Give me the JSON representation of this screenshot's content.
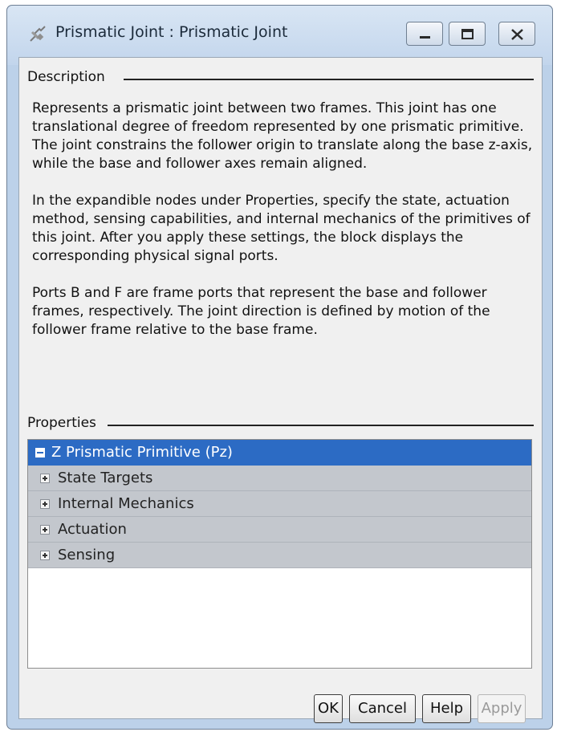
{
  "window": {
    "title": "Prismatic Joint : Prismatic  Joint"
  },
  "description": {
    "heading": "Description",
    "paragraphs": [
      "Represents a prismatic joint between two frames. This joint has one translational degree of freedom represented by one prismatic primitive. The joint constrains the follower origin to translate along the base z-axis, while the base and follower axes remain aligned.",
      "In the expandible nodes under Properties, specify the state, actuation method, sensing capabilities, and internal mechanics of the primitives of this joint. After you apply these settings, the block displays the corresponding physical signal ports.",
      "Ports B and F are frame ports that represent the base and follower frames, respectively. The joint direction is defined by motion of the follower frame relative to the base frame."
    ]
  },
  "properties": {
    "heading": "Properties",
    "root": {
      "label": "Z Prismatic Primitive (Pz)",
      "expanded": true,
      "selected": true
    },
    "children": [
      {
        "label": "State Targets",
        "expanded": false
      },
      {
        "label": "Internal Mechanics",
        "expanded": false
      },
      {
        "label": "Actuation",
        "expanded": false
      },
      {
        "label": "Sensing",
        "expanded": false
      }
    ]
  },
  "buttons": {
    "ok": "OK",
    "cancel": "Cancel",
    "help": "Help",
    "apply": "Apply",
    "apply_enabled": false
  },
  "icons": {
    "app": "prismatic-joint-icon",
    "minimize": "minimize-icon",
    "maximize": "maximize-icon",
    "close": "close-icon"
  },
  "colors": {
    "selection": "#2c6bc4",
    "node_row": "#c3c7cd",
    "frame": "#bcd1e9"
  }
}
